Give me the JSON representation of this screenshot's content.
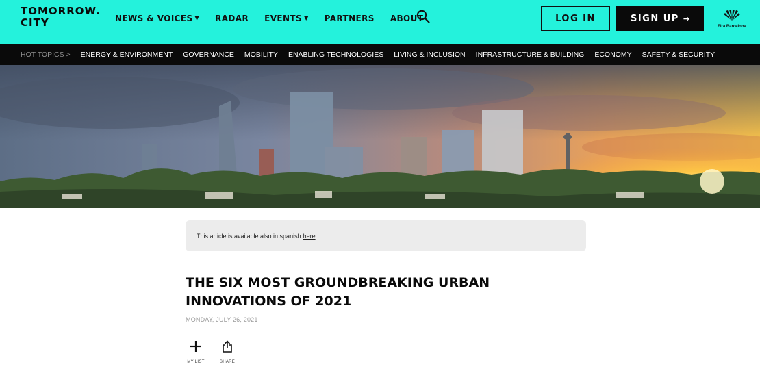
{
  "header": {
    "logo_line1": "TOMORROW.",
    "logo_line2": "CITY",
    "nav": [
      {
        "label": "NEWS & VOICES",
        "has_dropdown": true
      },
      {
        "label": "RADAR",
        "has_dropdown": false
      },
      {
        "label": "EVENTS",
        "has_dropdown": true
      },
      {
        "label": "PARTNERS",
        "has_dropdown": false
      },
      {
        "label": "ABOUT",
        "has_dropdown": false
      }
    ],
    "caret": "▼",
    "search_icon": "search-icon",
    "login_label": "LOG IN",
    "signup_label": "SIGN UP",
    "signup_arrow": "→",
    "partner_logo": "Fira Barcelona",
    "accent_color": "#24f2dc"
  },
  "hot_topics": {
    "label": "HOT TOPICS >",
    "items": [
      "ENERGY & ENVIRONMENT",
      "GOVERNANCE",
      "MOBILITY",
      "ENABLING TECHNOLOGIES",
      "LIVING & INCLUSION",
      "INFRASTRUCTURE & BUILDING",
      "ECONOMY",
      "SAFETY & SECURITY"
    ]
  },
  "article": {
    "notice_text": "This article is available also in spanish",
    "notice_link": "here",
    "title": "THE SIX MOST GROUNDBREAKING URBAN INNOVATIONS OF 2021",
    "date": "MONDAY, JULY 26, 2021",
    "actions": {
      "mylist_label": "MY LIST",
      "share_label": "SHARE"
    }
  }
}
